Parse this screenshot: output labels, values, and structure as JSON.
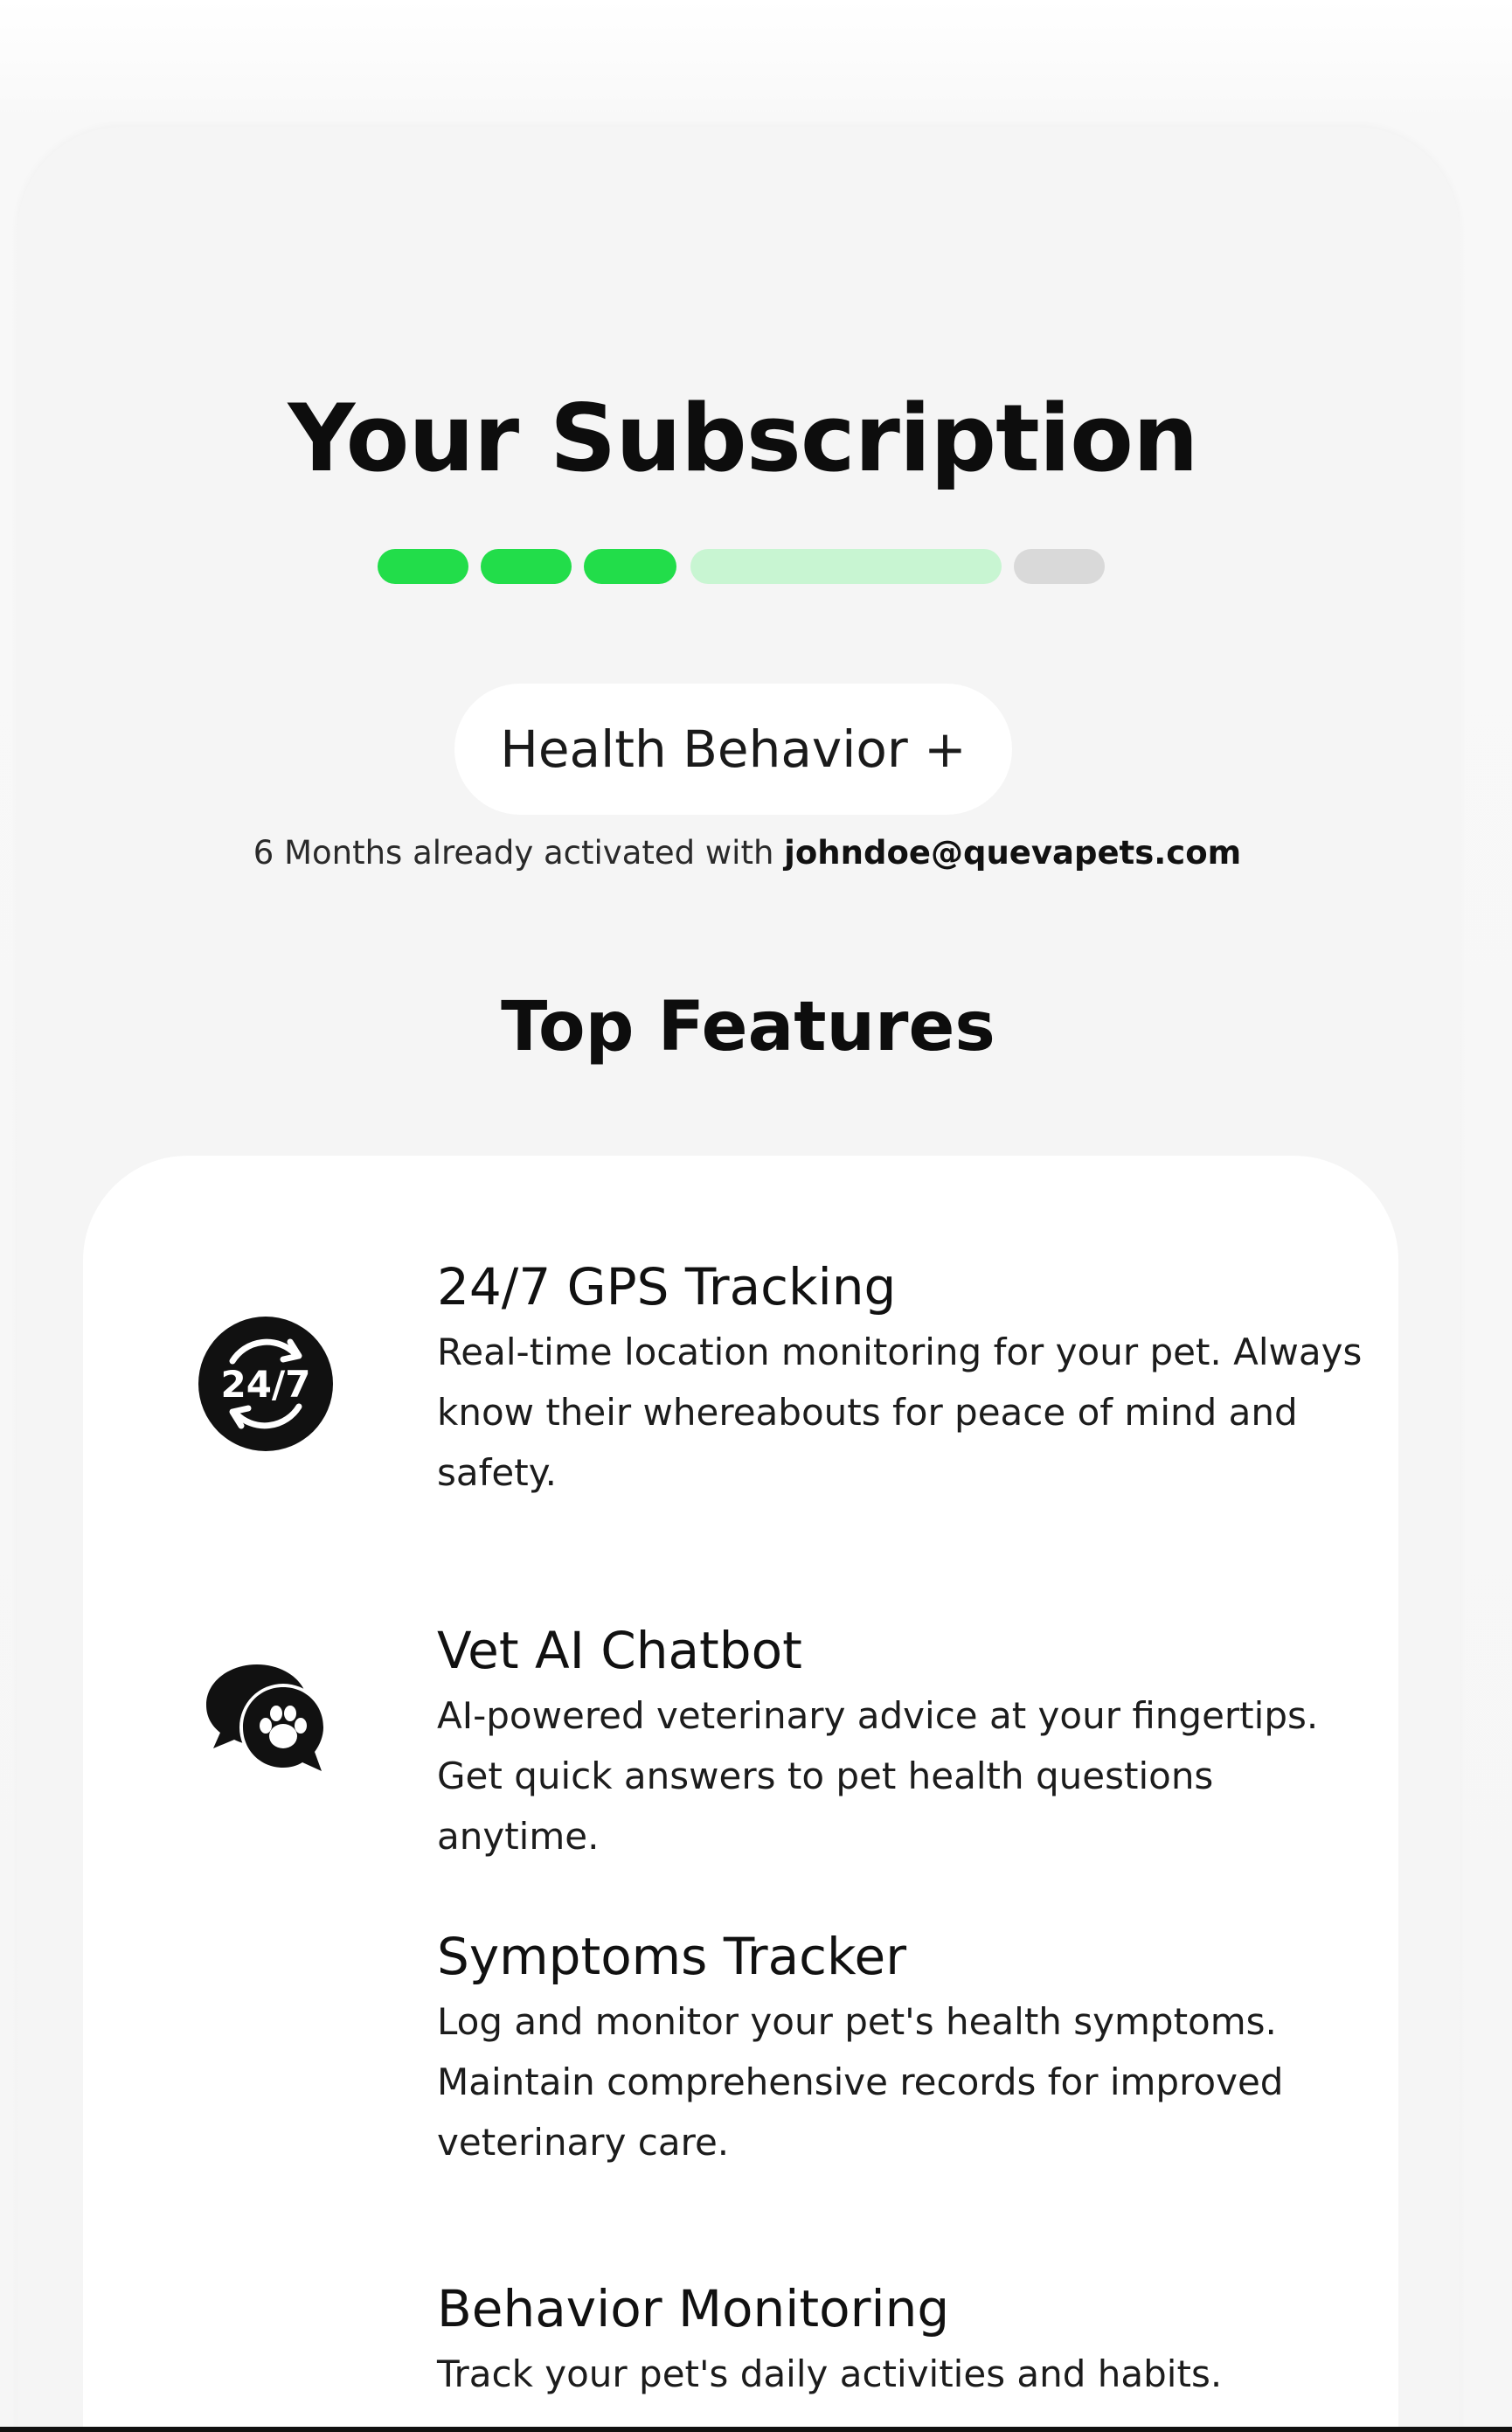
{
  "header": {
    "title": "Your Subscription"
  },
  "progress": {
    "completed_segments": 3,
    "total_segments": 5,
    "colors": {
      "complete": "#22dd4a",
      "current": "#c8f5d2",
      "pending": "#d9d9d9"
    }
  },
  "plan": {
    "name": "Health Behavior +"
  },
  "activation": {
    "text": "6 Months already activated with ",
    "email": "johndoe@quevapets.com"
  },
  "features_section": {
    "title": "Top Features",
    "items": [
      {
        "icon": "24-7-icon",
        "title": "24/7 GPS Tracking",
        "description": "Real-time location monitoring for your pet. Always know their whereabouts for peace of mind and safety."
      },
      {
        "icon": "chat-paw-icon",
        "title": "Vet AI Chatbot",
        "description": "AI-powered veterinary advice at your fingertips. Get quick answers to pet health questions anytime."
      },
      {
        "icon": "",
        "title": "Symptoms Tracker",
        "description": "Log and monitor your pet's health symptoms. Maintain comprehensive records for improved veterinary care."
      },
      {
        "icon": "",
        "title": "Behavior Monitoring",
        "description": "Track your pet's daily activities and habits."
      }
    ]
  }
}
